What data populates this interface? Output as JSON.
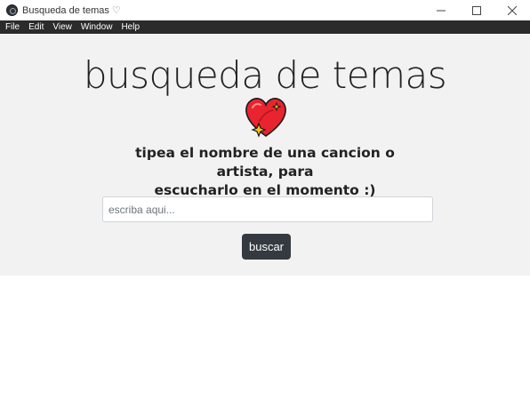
{
  "window": {
    "title": "Busqueda de temas",
    "title_icon": "heart-outline-icon",
    "controls": [
      "minimize-icon",
      "maximize-icon",
      "close-icon"
    ]
  },
  "menu": {
    "items": [
      {
        "label": "File"
      },
      {
        "label": "Edit"
      },
      {
        "label": "View"
      },
      {
        "label": "Window"
      },
      {
        "label": "Help"
      }
    ]
  },
  "main": {
    "title": "busqueda de temas",
    "emoji": "sparkling-heart-icon",
    "subtitle_line1": "tipea el nombre de una cancion o artista, para",
    "subtitle_line2": "escucharlo en el momento :)",
    "search": {
      "placeholder": "escriba aqui...",
      "value": ""
    },
    "button_label": "buscar"
  },
  "colors": {
    "menubar_bg": "#2b2b2b",
    "content_bg": "#f2f2f2",
    "button_bg": "#343a40",
    "heart": "#e8242f",
    "sparkle": "#f7c21c"
  }
}
